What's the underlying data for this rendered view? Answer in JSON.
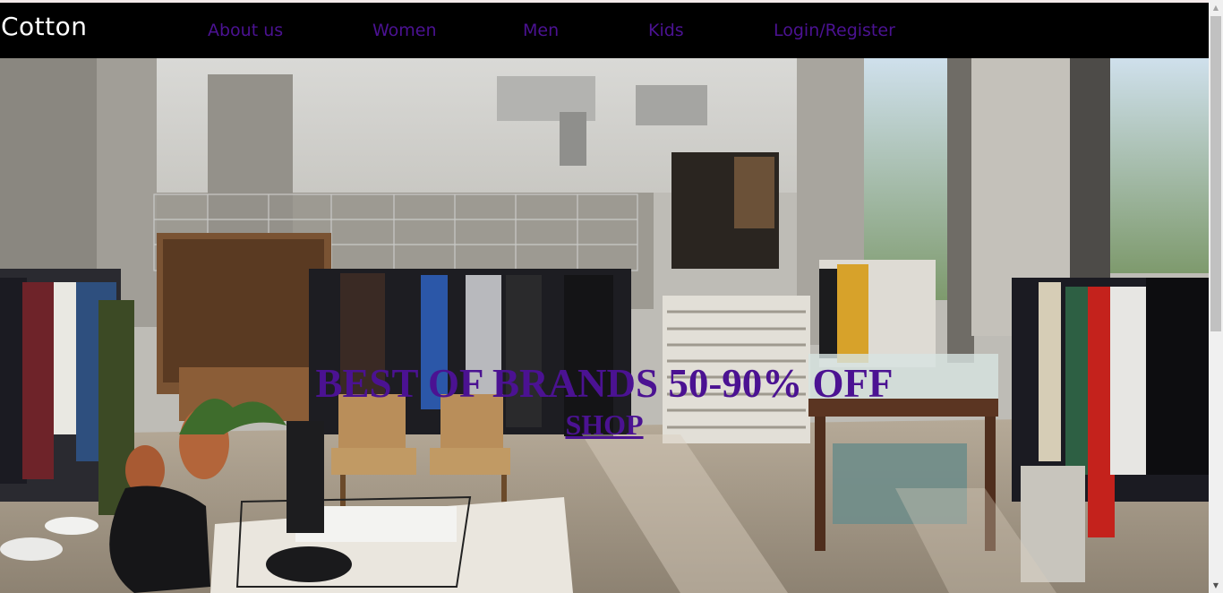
{
  "nav": {
    "brand": "Cotton",
    "links": [
      "About us",
      "Women",
      "Men",
      "Kids",
      "Login/Register"
    ]
  },
  "hero": {
    "headline": "BEST OF BRANDS 50-90% OFF",
    "cta": "SHOP"
  },
  "colors": {
    "accent": "#4b1292",
    "navbar_bg": "#000000",
    "brand_text": "#ffffff"
  },
  "icons": {
    "scroll_up": "triangle-up-icon",
    "scroll_down": "triangle-down-icon"
  }
}
